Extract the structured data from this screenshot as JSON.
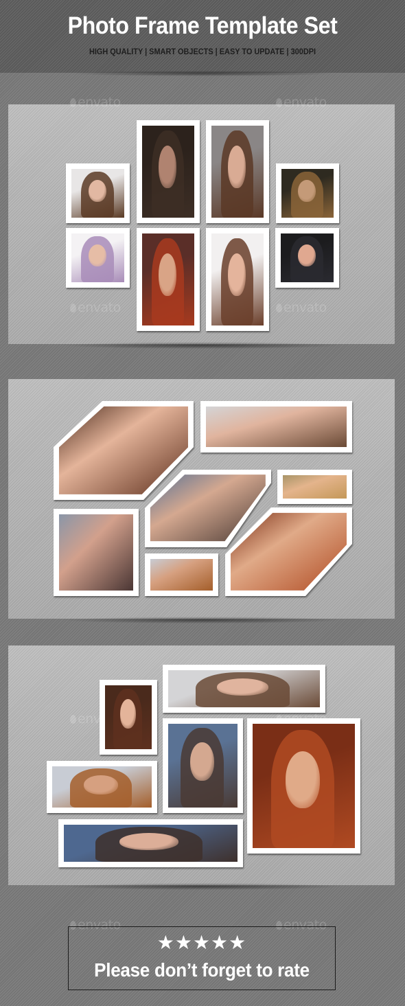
{
  "header": {
    "title": "Photo Frame Template Set",
    "subtitle": "HIGH QUALITY  | SMART OBJECTS | EASY TO UPDATE | 300DPI"
  },
  "watermark": {
    "text": "envato",
    "icon": "envato-leaf-icon"
  },
  "panels": [
    {
      "name": "template-1-grid",
      "frames": [
        {
          "subject": "Woman with curly brown hair, white background",
          "bg": "#e8e6e6",
          "hair": "#5a3a24",
          "skin": "#e2b8a2"
        },
        {
          "subject": "Woman lying with spread dark hair, eyes closed",
          "bg": "#2c221c",
          "hair": "#3d2e25",
          "skin": "#b08370"
        },
        {
          "subject": "Woman with long straight brown hair",
          "bg": "#8a8686",
          "hair": "#5a3826",
          "skin": "#d9ab94"
        },
        {
          "subject": "Woman with windswept golden hair, dark background",
          "bg": "#2e2a20",
          "hair": "#8a6438",
          "skin": "#c49a78"
        },
        {
          "subject": "Woman with flowers in hair",
          "bg": "#f4f2f4",
          "hair": "#a88cb8",
          "skin": "#e6bda6"
        },
        {
          "subject": "Woman with red bangs, profile",
          "bg": "#5a2e28",
          "hair": "#a83a1e",
          "skin": "#d9a486"
        },
        {
          "subject": "Woman with brown hair, hand on head",
          "bg": "#f2f0f0",
          "hair": "#6a3e2a",
          "skin": "#e4b49c"
        },
        {
          "subject": "Woman with sleek black hair, profile",
          "bg": "#1c1c1e",
          "hair": "#2a2a30",
          "skin": "#e0a890"
        }
      ]
    },
    {
      "name": "template-2-angled",
      "frames": [
        {
          "subject": "Close-up of woman with brown hair",
          "bg": "#4a2a1c",
          "hair": "#5e301e",
          "skin": "#e4b49a"
        },
        {
          "subject": "Woman touching hair, bokeh background",
          "bg": "#d4d4d6",
          "hair": "#6a4a36",
          "skin": "#e0b49e"
        },
        {
          "subject": "Woman with windblown hair, blue background",
          "bg": "#5a7294",
          "hair": "#4a3a34",
          "skin": "#d4a890"
        },
        {
          "subject": "Smiling blonde woman",
          "bg": "#a89468",
          "hair": "#c49858",
          "skin": "#e4b48c"
        },
        {
          "subject": "Woman in profile with hand near lips",
          "bg": "#8a96a8",
          "hair": "#4a3634",
          "skin": "#d2a08c"
        },
        {
          "subject": "Woman with flowing auburn curls",
          "bg": "#c8ccd4",
          "hair": "#a45e2a",
          "skin": "#d6a080"
        },
        {
          "subject": "Woman with red hair, eyes closed",
          "bg": "#7a2e16",
          "hair": "#b04a22",
          "skin": "#e0aa88"
        }
      ]
    },
    {
      "name": "template-3-mosaic",
      "frames": [
        {
          "subject": "Close-up of woman with brown hair",
          "bg": "#4a2a1c",
          "hair": "#5e301e",
          "skin": "#e4b49a"
        },
        {
          "subject": "Woman touching hair, bokeh background",
          "bg": "#d4d4d6",
          "hair": "#6a4a36",
          "skin": "#e0b49e"
        },
        {
          "subject": "Woman with windblown hair, blue background",
          "bg": "#5a7294",
          "hair": "#4a3a34",
          "skin": "#d4a890"
        },
        {
          "subject": "Woman with red hair, eyes closed",
          "bg": "#7a2e16",
          "hair": "#b04a22",
          "skin": "#e0aa88"
        },
        {
          "subject": "Woman with flowing auburn curls",
          "bg": "#c8ccd4",
          "hair": "#a45e2a",
          "skin": "#d6a080"
        },
        {
          "subject": "Woman holding hair strand, blue background",
          "bg": "#4e6890",
          "hair": "#3e302c",
          "skin": "#dcae98"
        }
      ]
    }
  ],
  "rating": {
    "stars": "★★★★★",
    "star_count": 5,
    "text": "Please don’t forget to rate"
  }
}
